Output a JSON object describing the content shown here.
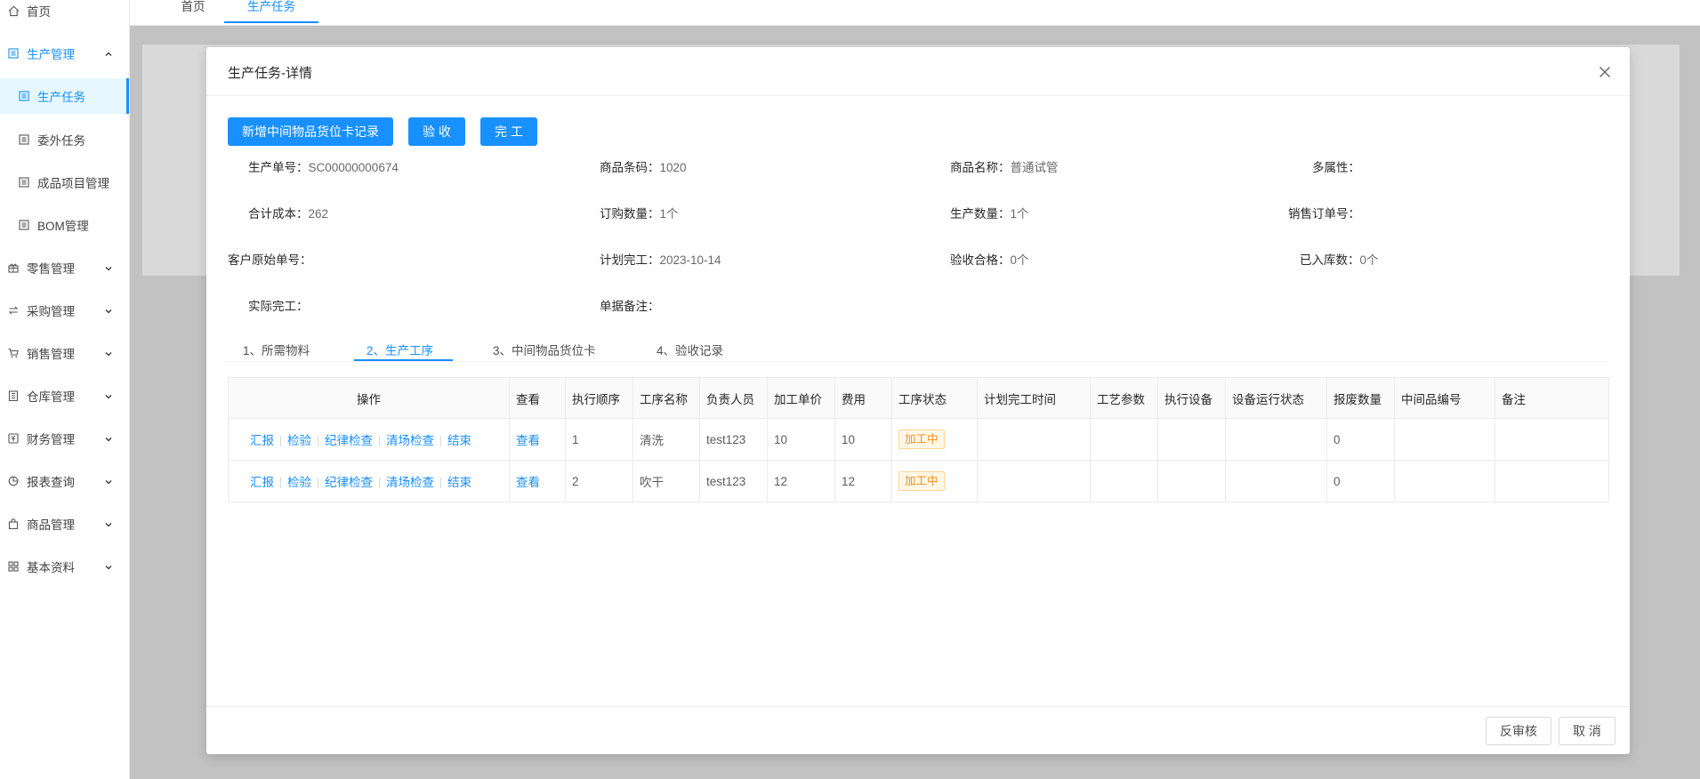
{
  "sidebar": {
    "items": [
      {
        "label": "首页",
        "icon": "home-icon"
      },
      {
        "label": "生产管理",
        "icon": "doc-icon"
      },
      {
        "label": "生产任务",
        "icon": "doc-icon"
      },
      {
        "label": "委外任务",
        "icon": "doc-icon"
      },
      {
        "label": "成品项目管理",
        "icon": "doc-icon"
      },
      {
        "label": "BOM管理",
        "icon": "doc-icon"
      },
      {
        "label": "零售管理",
        "icon": "gift-icon"
      },
      {
        "label": "采购管理",
        "icon": "swap-icon"
      },
      {
        "label": "销售管理",
        "icon": "cart-icon"
      },
      {
        "label": "仓库管理",
        "icon": "building-icon"
      },
      {
        "label": "财务管理",
        "icon": "money-icon"
      },
      {
        "label": "报表查询",
        "icon": "pie-icon"
      },
      {
        "label": "商品管理",
        "icon": "bag-icon"
      },
      {
        "label": "基本资料",
        "icon": "grid-icon"
      }
    ]
  },
  "topbar": {
    "tabs": [
      {
        "label": "首页"
      },
      {
        "label": "生产任务"
      }
    ]
  },
  "modal": {
    "title": "生产任务-详情",
    "buttons": {
      "add_card": "新增中间物品货位卡记录",
      "accept": "验 收",
      "finish": "完 工"
    },
    "fields": {
      "prod_no_label": "生产单号：",
      "prod_no": "SC00000000674",
      "barcode_label": "商品条码：",
      "barcode": "1020",
      "name_label": "商品名称：",
      "name": "普通试管",
      "attr_label": "多属性：",
      "cost_label": "合计成本：",
      "cost": "262",
      "order_qty_label": "订购数量：",
      "order_qty": "1个",
      "prod_qty_label": "生产数量：",
      "prod_qty": "1个",
      "sales_no_label": "销售订单号：",
      "cust_no_label": "客户原始单号：",
      "plan_done_label": "计划完工：",
      "plan_done": "2023-10-14",
      "pass_label": "验收合格：",
      "pass": "0个",
      "stock_label": "已入库数：",
      "stock": "0个",
      "actual_done_label": "实际完工：",
      "remark_label": "单据备注："
    },
    "tabs": [
      {
        "label": "1、所需物料"
      },
      {
        "label": "2、生产工序"
      },
      {
        "label": "3、中间物品货位卡"
      },
      {
        "label": "4、验收记录"
      }
    ],
    "table": {
      "headers": [
        "操作",
        "查看",
        "执行顺序",
        "工序名称",
        "负责人员",
        "加工单价",
        "费用",
        "工序状态",
        "计划完工时间",
        "工艺参数",
        "执行设备",
        "设备运行状态",
        "报废数量",
        "中间品编号",
        "备注"
      ],
      "op_links": [
        "汇报",
        "检验",
        "纪律检查",
        "清场检查",
        "结束"
      ],
      "view_label": "查看",
      "rows": [
        {
          "seq": "1",
          "name": "清洗",
          "person": "test123",
          "price": "10",
          "fee": "10",
          "status": "加工中",
          "plan": "",
          "param": "",
          "device": "",
          "device_state": "",
          "scrap": "0",
          "mid_no": "",
          "remark": ""
        },
        {
          "seq": "2",
          "name": "吹干",
          "person": "test123",
          "price": "12",
          "fee": "12",
          "status": "加工中",
          "plan": "",
          "param": "",
          "device": "",
          "device_state": "",
          "scrap": "0",
          "mid_no": "",
          "remark": ""
        }
      ]
    },
    "footer": {
      "unapprove": "反审核",
      "cancel": "取 消"
    }
  },
  "colors": {
    "primary": "#1890ff",
    "status_tag": "#fa8c16"
  }
}
